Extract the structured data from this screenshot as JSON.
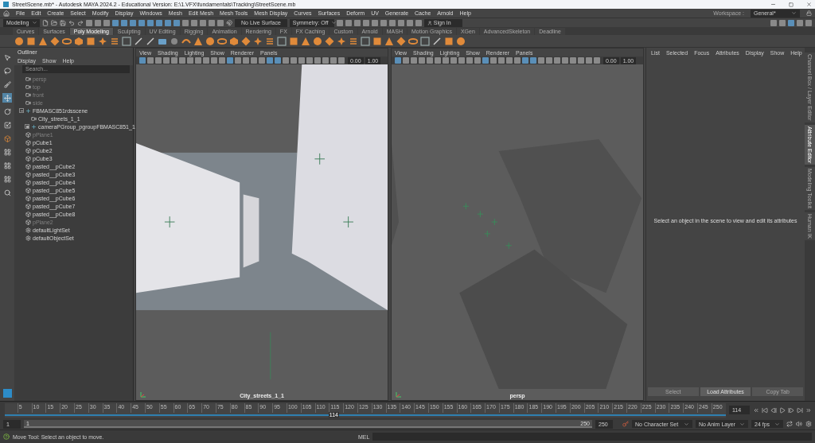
{
  "window": {
    "title": "StreetScene.mb* - Autodesk MAYA 2024.2 - Educational Version: E:\\1.VFX\\fundamentals\\Tracking\\StreetScene.mb"
  },
  "menu": [
    "File",
    "Edit",
    "Create",
    "Select",
    "Modify",
    "Display",
    "Windows",
    "Mesh",
    "Edit Mesh",
    "Mesh Tools",
    "Mesh Display",
    "Curves",
    "Surfaces",
    "Deform",
    "UV",
    "Generate",
    "Cache",
    "Arnold",
    "Help"
  ],
  "workspace": {
    "label": "Workspace :",
    "value": "General*"
  },
  "status_line": {
    "menu_set": "Modeling",
    "live_surface": "No Live Surface",
    "symmetry": "Symmetry: Off",
    "sign_in": "Sign In"
  },
  "shelf_tabs": [
    {
      "label": "Curves",
      "selected": false
    },
    {
      "label": "Surfaces",
      "selected": false
    },
    {
      "label": "Poly Modeling",
      "selected": true
    },
    {
      "label": "Sculpting",
      "selected": false
    },
    {
      "label": "UV Editing",
      "selected": false
    },
    {
      "label": "Rigging",
      "selected": false
    },
    {
      "label": "Animation",
      "selected": false
    },
    {
      "label": "Rendering",
      "selected": false
    },
    {
      "label": "FX",
      "selected": false
    },
    {
      "label": "FX Caching",
      "selected": false
    },
    {
      "label": "Custom",
      "selected": false
    },
    {
      "label": "Arnold",
      "selected": false
    },
    {
      "label": "MASH",
      "selected": false
    },
    {
      "label": "Motion Graphics",
      "selected": false
    },
    {
      "label": "XGen",
      "selected": false
    },
    {
      "label": "AdvancedSkeleton",
      "selected": false
    },
    {
      "label": "Deadline",
      "selected": false
    }
  ],
  "outliner": {
    "title": "Outliner",
    "menu": [
      "Display",
      "Show",
      "Help"
    ],
    "search_placeholder": "Search...",
    "items": [
      {
        "name": "persp",
        "kind": "camera",
        "hidden": true
      },
      {
        "name": "top",
        "kind": "camera",
        "hidden": true
      },
      {
        "name": "front",
        "kind": "camera",
        "hidden": true
      },
      {
        "name": "side",
        "kind": "camera",
        "hidden": true
      },
      {
        "name": "FBMASC851rdsscene",
        "kind": "group",
        "hidden": false,
        "expanded": true,
        "children": [
          {
            "name": "City_streets_1_1",
            "kind": "camera",
            "hidden": false
          },
          {
            "name": "cameraPGroup_pgroupFBMASC851_1",
            "kind": "group",
            "hidden": false,
            "expanded": false
          }
        ]
      },
      {
        "name": "pPlane1",
        "kind": "mesh",
        "hidden": true
      },
      {
        "name": "pCube1",
        "kind": "mesh",
        "hidden": false
      },
      {
        "name": "pCube2",
        "kind": "mesh",
        "hidden": false
      },
      {
        "name": "pCube3",
        "kind": "mesh",
        "hidden": false
      },
      {
        "name": "pasted__pCube2",
        "kind": "mesh",
        "hidden": false
      },
      {
        "name": "pasted__pCube3",
        "kind": "mesh",
        "hidden": false
      },
      {
        "name": "pasted__pCube4",
        "kind": "mesh",
        "hidden": false
      },
      {
        "name": "pasted__pCube5",
        "kind": "mesh",
        "hidden": false
      },
      {
        "name": "pasted__pCube6",
        "kind": "mesh",
        "hidden": false
      },
      {
        "name": "pasted__pCube7",
        "kind": "mesh",
        "hidden": false
      },
      {
        "name": "pasted__pCube8",
        "kind": "mesh",
        "hidden": false
      },
      {
        "name": "pPlane2",
        "kind": "mesh",
        "hidden": true
      },
      {
        "name": "defaultLightSet",
        "kind": "set",
        "hidden": false
      },
      {
        "name": "defaultObjectSet",
        "kind": "set",
        "hidden": false
      }
    ]
  },
  "viewports": [
    {
      "menu": [
        "View",
        "Shading",
        "Lighting",
        "Show",
        "Renderer",
        "Panels"
      ],
      "exposure": "0.00",
      "gamma": "1.00",
      "camera_label": "City_streets_1_1",
      "kind": "camera"
    },
    {
      "menu": [
        "View",
        "Shading",
        "Lighting",
        "Show",
        "Renderer",
        "Panels"
      ],
      "exposure": "0.00",
      "gamma": "1.00",
      "camera_label": "persp",
      "kind": "persp"
    }
  ],
  "attribute_editor": {
    "menu": [
      "List",
      "Selected",
      "Focus",
      "Attributes",
      "Display",
      "Show",
      "Help"
    ],
    "message": "Select an object in the scene to view and edit its attributes",
    "buttons": [
      "Select",
      "Load Attributes",
      "Copy Tab"
    ]
  },
  "side_tabs": [
    {
      "label": "Channel Box / Layer Editor",
      "selected": false
    },
    {
      "label": "Attribute Editor",
      "selected": true
    },
    {
      "label": "Modeling Toolkit",
      "selected": false
    },
    {
      "label": "Human IK",
      "selected": false
    }
  ],
  "time_slider": {
    "ticks": [
      "5",
      "10",
      "15",
      "20",
      "25",
      "30",
      "35",
      "40",
      "45",
      "50",
      "55",
      "60",
      "65",
      "70",
      "75",
      "80",
      "85",
      "90",
      "95",
      "100",
      "105",
      "110",
      "115",
      "120",
      "125",
      "130",
      "135",
      "140",
      "145",
      "150",
      "155",
      "160",
      "165",
      "170",
      "175",
      "180",
      "185",
      "190",
      "195",
      "200",
      "205",
      "210",
      "215",
      "220",
      "225",
      "230",
      "235",
      "240",
      "245",
      "250"
    ],
    "current": "114",
    "level": 0.449,
    "current_field": "114"
  },
  "range_slider": {
    "level": 1,
    "start": "1",
    "range_start": "1",
    "range_end": "250",
    "end": "250",
    "character_set": "No Character Set",
    "anim_layer": "No Anim Layer",
    "fps": "24 fps"
  },
  "help_line": {
    "text": "Move Tool: Select an object to move.",
    "command_label": "MEL"
  }
}
